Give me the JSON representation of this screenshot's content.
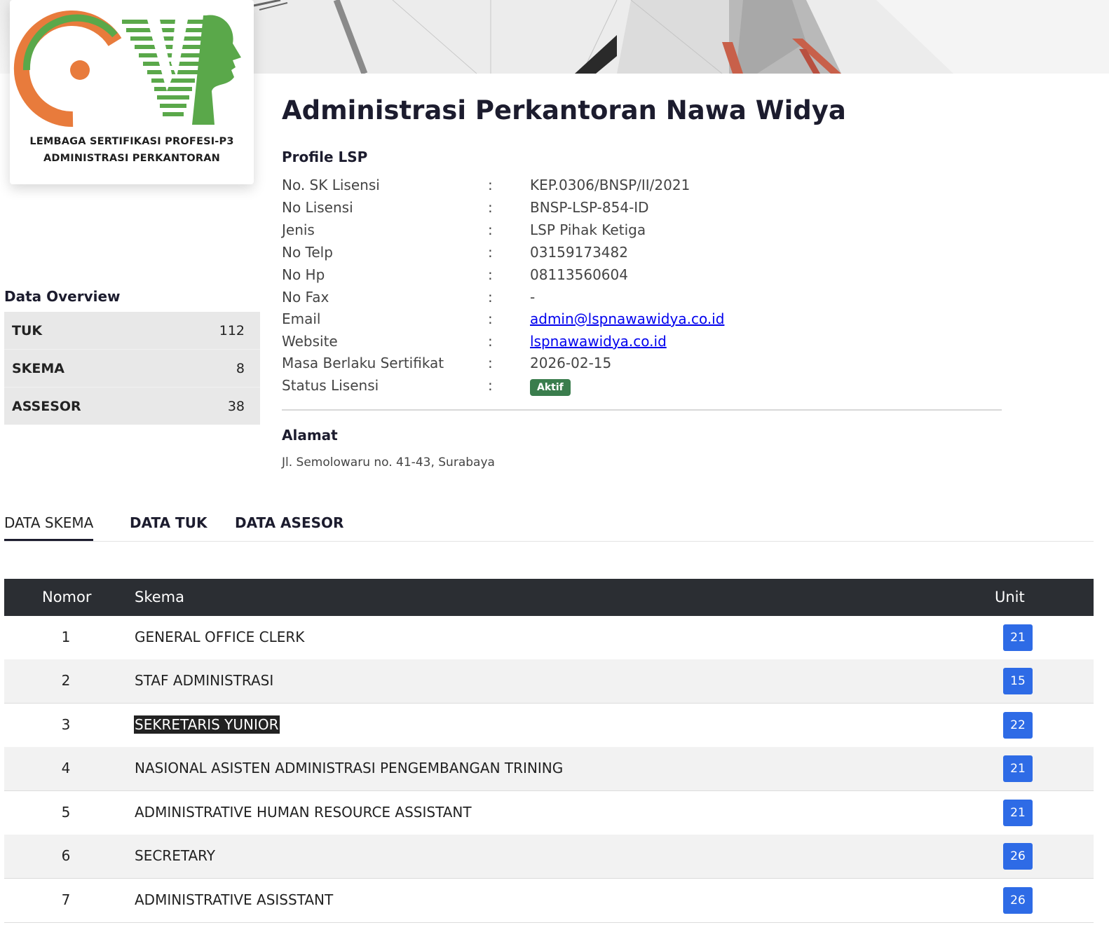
{
  "logo": {
    "line1": "LEMBAGA SERTIFIKASI PROFESI-P3",
    "line2": "ADMINISTRASI PERKANTORAN",
    "colors": {
      "orange": "#e87b3c",
      "green": "#5aa84a"
    }
  },
  "title": "Administrasi Perkantoran Nawa Widya",
  "profile": {
    "heading": "Profile LSP",
    "rows": [
      {
        "label": "No. SK Lisensi",
        "value": "KEP.0306/BNSP/II/2021"
      },
      {
        "label": "No Lisensi",
        "value": "BNSP-LSP-854-ID"
      },
      {
        "label": "Jenis",
        "value": "LSP Pihak Ketiga"
      },
      {
        "label": "No Telp",
        "value": "03159173482"
      },
      {
        "label": "No Hp",
        "value": "08113560604"
      },
      {
        "label": "No Fax",
        "value": "-"
      },
      {
        "label": "Email",
        "value": "admin@lspnawawidya.co.id"
      },
      {
        "label": "Website",
        "value": "lspnawawidya.co.id"
      },
      {
        "label": "Masa Berlaku Sertifikat",
        "value": "2026-02-15"
      },
      {
        "label": "Status Lisensi",
        "value": "Aktif"
      }
    ],
    "colon": ":"
  },
  "alamat": {
    "heading": "Alamat",
    "text": "Jl. Semolowaru no. 41-43, Surabaya"
  },
  "overview": {
    "heading": "Data Overview",
    "items": [
      {
        "label": "TUK",
        "value": "112"
      },
      {
        "label": "SKEMA",
        "value": "8"
      },
      {
        "label": "ASSESOR",
        "value": "38"
      }
    ]
  },
  "tabs": [
    {
      "label": "DATA SKEMA",
      "active": true
    },
    {
      "label": "DATA TUK",
      "active": false
    },
    {
      "label": "DATA ASESOR",
      "active": false
    }
  ],
  "table": {
    "headers": {
      "nomor": "Nomor",
      "skema": "Skema",
      "unit": "Unit"
    },
    "rows": [
      {
        "nomor": "1",
        "skema": "GENERAL OFFICE CLERK",
        "unit": "21"
      },
      {
        "nomor": "2",
        "skema": "STAF ADMINISTRASI",
        "unit": "15"
      },
      {
        "nomor": "3",
        "skema": "SEKRETARIS YUNIOR",
        "unit": "22",
        "selected": true
      },
      {
        "nomor": "4",
        "skema": "NASIONAL ASISTEN ADMINISTRASI PENGEMBANGAN TRINING",
        "unit": "21"
      },
      {
        "nomor": "5",
        "skema": "ADMINISTRATIVE HUMAN RESOURCE ASSISTANT",
        "unit": "21"
      },
      {
        "nomor": "6",
        "skema": "SECRETARY",
        "unit": "26"
      },
      {
        "nomor": "7",
        "skema": "ADMINISTRATIVE ASISSTANT",
        "unit": "26"
      }
    ]
  },
  "colors": {
    "status_active": "#3a7d4d",
    "unit_badge": "#2e6be6",
    "table_header": "#2b2e33"
  }
}
